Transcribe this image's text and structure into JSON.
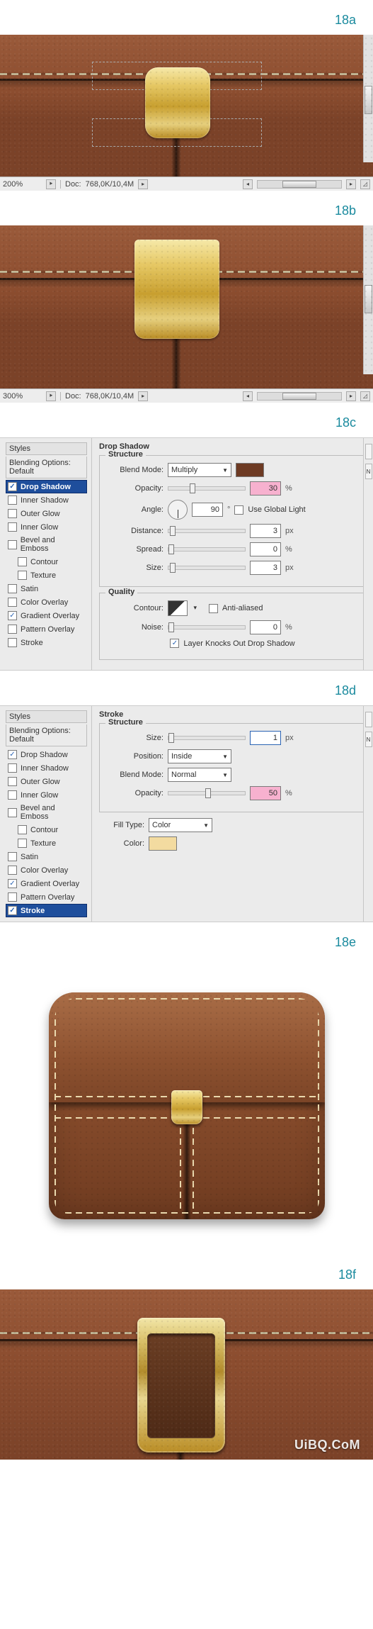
{
  "labels": {
    "s18a": "18a",
    "s18b": "18b",
    "s18c": "18c",
    "s18d": "18d",
    "s18e": "18e",
    "s18f": "18f"
  },
  "status": {
    "doc_label": "Doc:",
    "doc_value": "768,0K/10,4M",
    "zoom_18a": "200%",
    "zoom_18b": "300%"
  },
  "styles_list": [
    {
      "id": "blending-default",
      "label": "Blending Options: Default",
      "type": "default"
    },
    {
      "id": "drop-shadow",
      "label": "Drop Shadow",
      "checkbox": true
    },
    {
      "id": "inner-shadow",
      "label": "Inner Shadow",
      "checkbox": false
    },
    {
      "id": "outer-glow",
      "label": "Outer Glow",
      "checkbox": false
    },
    {
      "id": "inner-glow",
      "label": "Inner Glow",
      "checkbox": false
    },
    {
      "id": "bevel-emboss",
      "label": "Bevel and Emboss",
      "checkbox": false
    },
    {
      "id": "contour",
      "label": "Contour",
      "checkbox": false,
      "indent": true
    },
    {
      "id": "texture",
      "label": "Texture",
      "checkbox": false,
      "indent": true
    },
    {
      "id": "satin",
      "label": "Satin",
      "checkbox": false
    },
    {
      "id": "color-overlay",
      "label": "Color Overlay",
      "checkbox": false
    },
    {
      "id": "gradient-overlay",
      "label": "Gradient Overlay",
      "checkbox": true
    },
    {
      "id": "pattern-overlay",
      "label": "Pattern Overlay",
      "checkbox": false
    },
    {
      "id": "stroke",
      "label": "Stroke",
      "checkbox": true
    }
  ],
  "panel_c": {
    "styles_heading": "Styles",
    "active_id": "drop-shadow",
    "checked": {
      "drop-shadow": true,
      "gradient-overlay": true
    },
    "title": "Drop Shadow",
    "structure_legend": "Structure",
    "quality_legend": "Quality",
    "blend_mode_label": "Blend Mode:",
    "blend_mode_value": "Multiply",
    "color_swatch": "#6d3a23",
    "opacity_label": "Opacity:",
    "opacity_value": "30",
    "opacity_unit": "%",
    "angle_label": "Angle:",
    "angle_value": "90",
    "angle_unit": "°",
    "use_global_light_label": "Use Global Light",
    "use_global_light_checked": false,
    "distance_label": "Distance:",
    "distance_value": "3",
    "distance_unit": "px",
    "spread_label": "Spread:",
    "spread_value": "0",
    "spread_unit": "%",
    "size_label": "Size:",
    "size_value": "3",
    "size_unit": "px",
    "contour_label": "Contour:",
    "anti_aliased_label": "Anti-aliased",
    "anti_aliased_checked": false,
    "noise_label": "Noise:",
    "noise_value": "0",
    "noise_unit": "%",
    "knockout_label": "Layer Knocks Out Drop Shadow",
    "knockout_checked": true,
    "side_button": "N"
  },
  "panel_d": {
    "styles_heading": "Styles",
    "active_id": "stroke",
    "checked": {
      "drop-shadow": true,
      "gradient-overlay": true,
      "stroke": true
    },
    "title": "Stroke",
    "structure_legend": "Structure",
    "size_label": "Size:",
    "size_value": "1",
    "size_unit": "px",
    "position_label": "Position:",
    "position_value": "Inside",
    "blend_mode_label": "Blend Mode:",
    "blend_mode_value": "Normal",
    "opacity_label": "Opacity:",
    "opacity_value": "50",
    "opacity_unit": "%",
    "fill_type_label": "Fill Type:",
    "fill_type_value": "Color",
    "color_label": "Color:",
    "color_swatch": "#f3dba0",
    "side_button": "N"
  },
  "watermark": "UiBQ.CoM"
}
